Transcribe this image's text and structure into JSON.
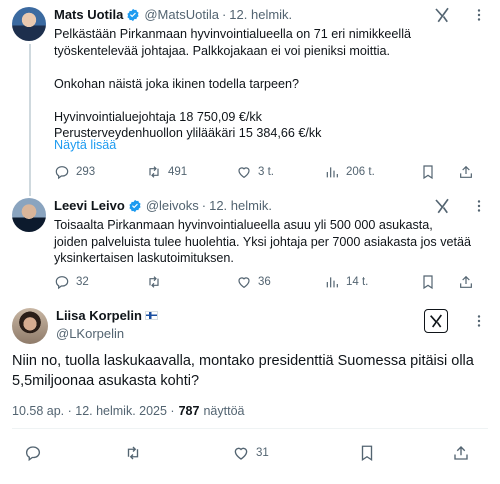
{
  "tweet1": {
    "name": "Mats Uotila",
    "handle": "@MatsUotila",
    "date": "12. helmik.",
    "text": "Pelkästään Pirkanmaan hyvinvointialueella on 71 eri nimikkeellä\ntyöskentelevää johtajaa. Palkkojakaan ei voi pieniksi moittia.\n\nOnkohan näistä joka ikinen todella tarpeen?\n\nHyvinvointialuejohtaja 18 750,09 €/kk\nPerusterveydenhuollon ylilääkäri 15 384,66 €/kk",
    "show_more": "Näytä lisää",
    "replies": "293",
    "reposts": "491",
    "likes": "3 t.",
    "views": "206 t."
  },
  "tweet2": {
    "name": "Leevi Leivo",
    "handle": "@leivoks",
    "date": "12. helmik.",
    "text": "Toisaalta Pirkanmaan hyvinvointialueella asuu yli 500 000 asukasta,\njoiden palveluista tulee huolehtia. Yksi johtaja per 7000 asiakasta jos vetää\nyksinkertaisen laskutoimituksen.",
    "replies": "32",
    "reposts": "",
    "likes": "36",
    "views": "14 t."
  },
  "tweet3": {
    "name": "Liisa Korpelin",
    "handle": "@LKorpelin",
    "text": "Niin no, tuolla laskukaavalla, montako presidenttiä Suomessa pitäisi olla\n5,5miljoonaa asukasta kohti?",
    "timestamp": "10.58 ap. · 12. helmik. 2025 ·",
    "view_count": "787",
    "views_label": "näyttöä",
    "likes": "31"
  },
  "colors": {
    "verified": "#1d9bf0",
    "muted": "#536471",
    "link": "#1d9bf0"
  }
}
